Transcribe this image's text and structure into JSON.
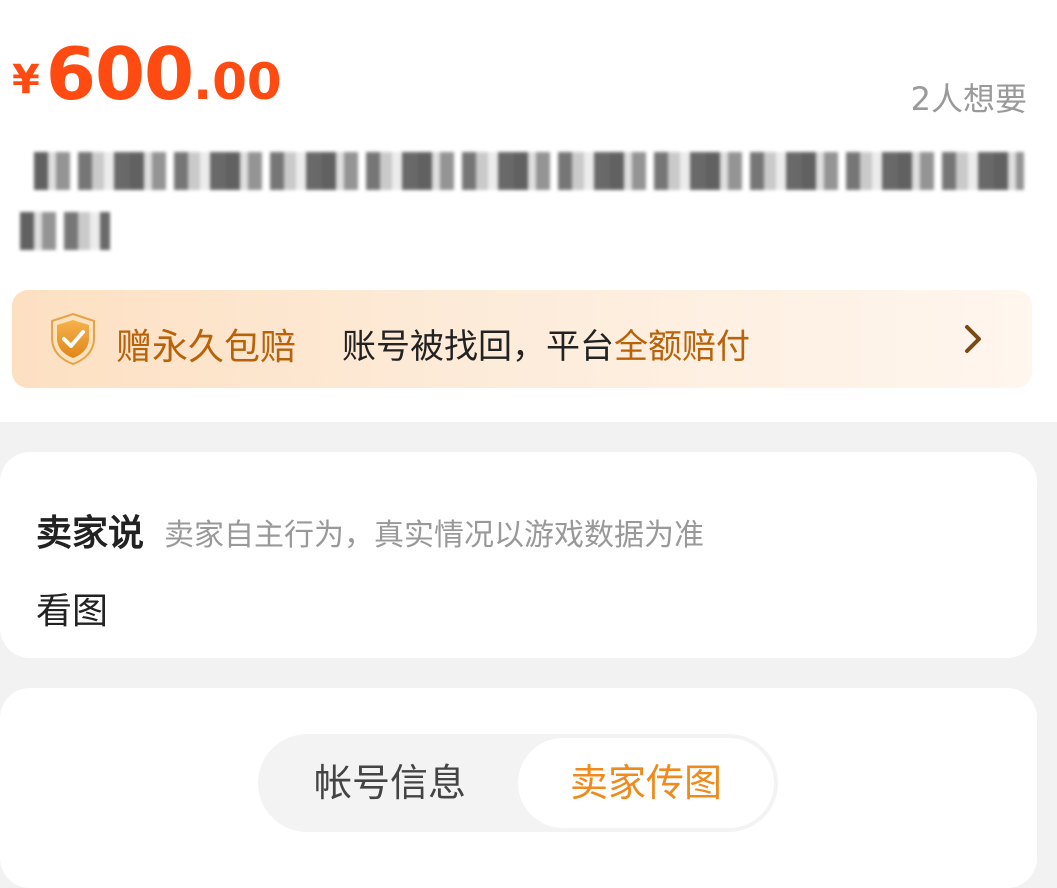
{
  "listing": {
    "price_currency": "¥",
    "price_integer": "600",
    "price_decimal": ".00",
    "wants_count": "2人想要"
  },
  "guarantee": {
    "title": "赠永久包赔",
    "text_prefix": "账号被找回，平台",
    "text_highlight": "全额赔付",
    "accent_color": "#b8620a",
    "icons": [
      "shield-check-icon",
      "chevron-right-icon"
    ]
  },
  "seller": {
    "heading": "卖家说",
    "note": "卖家自主行为，真实情况以游戏数据为准",
    "body": "看图"
  },
  "tabs": {
    "items": [
      {
        "label": "帐号信息",
        "selected": false
      },
      {
        "label": "卖家传图",
        "selected": true
      }
    ],
    "selected_color": "#f08a1c"
  },
  "colors": {
    "price": "#ff4b12",
    "background": "#f2f2f2"
  }
}
